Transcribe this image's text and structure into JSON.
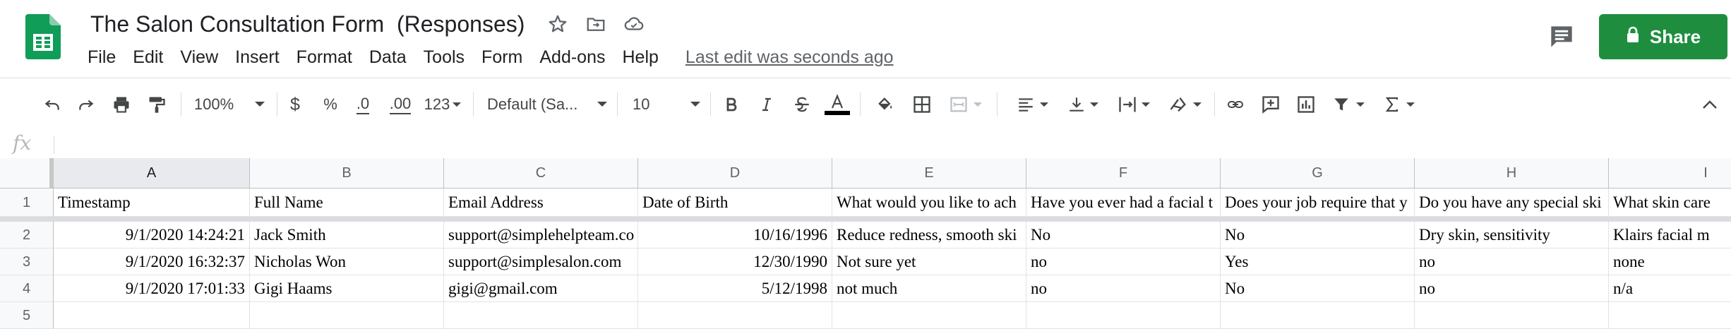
{
  "doc": {
    "title": "The Salon Consultation Form  (Responses)",
    "last_edit": "Last edit was seconds ago"
  },
  "menu": [
    "File",
    "Edit",
    "View",
    "Insert",
    "Format",
    "Data",
    "Tools",
    "Form",
    "Add-ons",
    "Help"
  ],
  "share": {
    "label": "Share"
  },
  "toolbar": {
    "zoom": "100%",
    "currency": "$",
    "percent": "%",
    "decrease_decimal": ".0",
    "increase_decimal": ".00",
    "more_formats": "123",
    "font": "Default (Sa...",
    "font_size": "10"
  },
  "formula": {
    "fx": "fx",
    "value": ""
  },
  "columns": [
    "A",
    "B",
    "C",
    "D",
    "E",
    "F",
    "G",
    "H",
    "I"
  ],
  "rows": [
    {
      "num": "1",
      "cells": [
        "Timestamp",
        "Full Name",
        "Email Address",
        "Date of Birth",
        "What would you like to ach",
        "Have you ever had a facial t",
        "Does your job require that y",
        "Do you have any special ski",
        "What skin care"
      ]
    },
    {
      "num": "2",
      "cells": [
        "9/1/2020 14:24:21",
        "Jack Smith",
        "support@simplehelpteam.co",
        "10/16/1996",
        "Reduce redness, smooth ski",
        "No",
        "No",
        "Dry skin, sensitivity",
        "Klairs facial m"
      ]
    },
    {
      "num": "3",
      "cells": [
        "9/1/2020 16:32:37",
        "Nicholas Won",
        "support@simplesalon.com",
        "12/30/1990",
        "Not sure yet",
        "no",
        "Yes",
        "no",
        "none"
      ]
    },
    {
      "num": "4",
      "cells": [
        "9/1/2020 17:01:33",
        "Gigi Haams",
        "gigi@gmail.com",
        "5/12/1998",
        "not much",
        "no",
        "No",
        "no",
        "n/a"
      ]
    },
    {
      "num": "5",
      "cells": [
        "",
        "",
        "",
        "",
        "",
        "",
        "",
        "",
        ""
      ]
    }
  ],
  "colors": {
    "sheets_green": "#0f9d58",
    "share_green": "#1e8e3e",
    "header_bg": "#f8f9fa",
    "selected_header_bg": "#e8eaed"
  }
}
